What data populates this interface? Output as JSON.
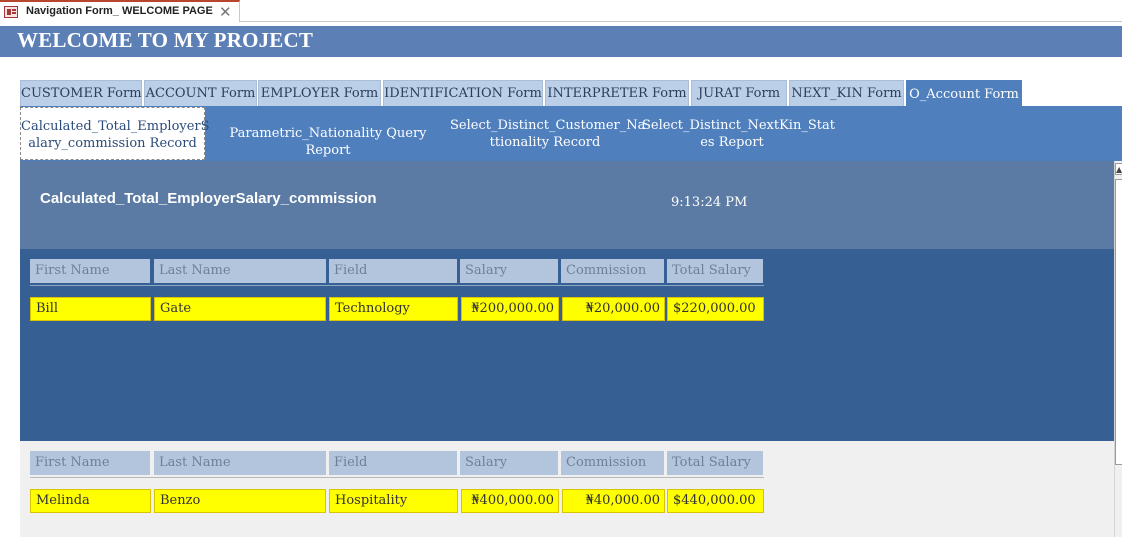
{
  "window": {
    "tab_title": "Navigation Form_ WELCOME PAGE",
    "close_glyph": "✕",
    "icon": "form-icon"
  },
  "header": {
    "title": "WELCOME TO MY PROJECT",
    "band_color": "#5c7fb6"
  },
  "nav_tabs": [
    {
      "label": "CUSTOMER Form",
      "active": false
    },
    {
      "label": "ACCOUNT Form",
      "active": false
    },
    {
      "label": "EMPLOYER Form",
      "active": false
    },
    {
      "label": "IDENTIFICATION Form",
      "active": false
    },
    {
      "label": "INTERPRETER Form",
      "active": false
    },
    {
      "label": "JURAT Form",
      "active": false
    },
    {
      "label": "NEXT_KIN Form",
      "active": false
    },
    {
      "label": "O_Account Form",
      "active": true
    }
  ],
  "sub_nav": [
    {
      "line1": "Calculated_Total_EmployerS",
      "line2": "alary_commission Record",
      "active": true
    },
    {
      "line1": "Parametric_Nationality Query Report",
      "line2": "",
      "active": false
    },
    {
      "line1": "Select_Distinct_Customer_Na",
      "line2": "ttionality Record",
      "active": false
    },
    {
      "line1": "Select_Distinct_NextKin_Stat",
      "line2": "es Report",
      "active": false
    }
  ],
  "report": {
    "title": "Calculated_Total_EmployerSalary_commission",
    "time": "9:13:24 PM",
    "columns": [
      "First Name",
      "Last Name",
      "Field",
      "Salary",
      "Commission",
      "Total Salary"
    ],
    "records": [
      [
        "Bill",
        "Gate",
        "Technology",
        "₦200,000.00",
        "₦20,000.00",
        "$220,000.00"
      ],
      [
        "Melinda",
        "Benzo",
        "Hospitality",
        "₦400,000.00",
        "₦40,000.00",
        "$440,000.00"
      ]
    ]
  },
  "colors": {
    "accent": "#4f7fbd",
    "report_header": "#5b7ba4",
    "section_dark": "#365f94",
    "highlight": "#ffff00"
  }
}
